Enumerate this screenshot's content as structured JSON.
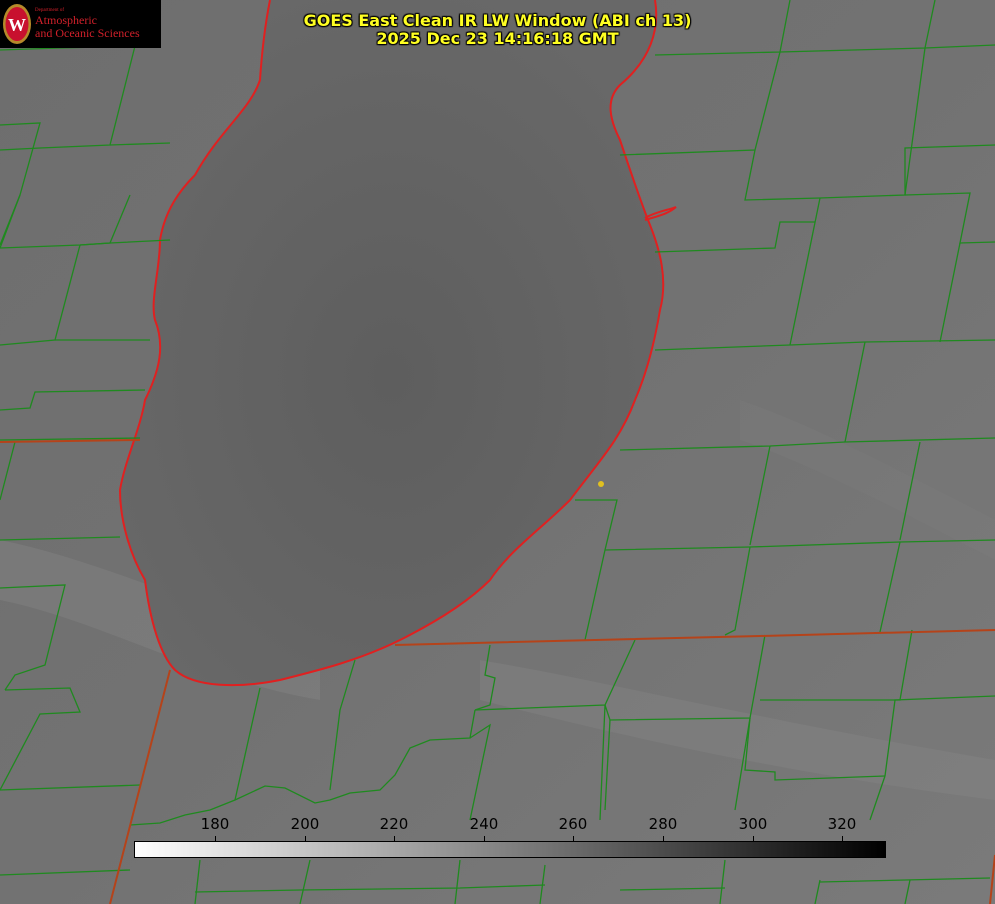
{
  "title": {
    "line1": "GOES East Clean IR LW Window (ABI ch 13)",
    "line2": "2025 Dec 23 14:16:18 GMT"
  },
  "logo": {
    "department": "Department of",
    "line1": "Atmospheric",
    "line2": "and Oceanic Sciences",
    "seal_letter": "W"
  },
  "colorbar": {
    "ticks": [
      "180",
      "200",
      "220",
      "240",
      "260",
      "280",
      "300",
      "320"
    ],
    "start_color": "#ffffff",
    "end_color": "#000000"
  },
  "colors": {
    "county_lines": "#1f8a1f",
    "state_lines": "#b5431a",
    "coastline": "#e02020",
    "marker": "#e0c020",
    "title_text": "#ffff22"
  }
}
